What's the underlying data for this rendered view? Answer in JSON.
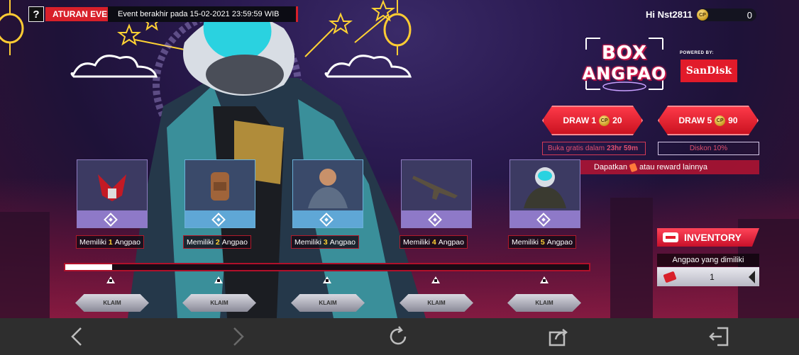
{
  "event": {
    "rules_button_icon": "question-icon",
    "rules_label": "ATURAN EVENT",
    "end_text": "Event berakhir pada 15-02-2021 23:59:59 WIB"
  },
  "user": {
    "greeting": "Hi Nst2811",
    "coin_icon": "cp-coin-icon",
    "coin_text": "CP",
    "balance": "0"
  },
  "logo": {
    "line1": "BOX",
    "line2": "ANGPAO",
    "powered_by": "POWERED BY:",
    "sponsor": "SanDisk"
  },
  "draw": [
    {
      "label": "DRAW 1",
      "cost": "20",
      "note_prefix": "Buka gratis dalam",
      "note_time": "23hr 59m"
    },
    {
      "label": "DRAW 5",
      "cost": "90",
      "note": "Diskon 10%"
    }
  ],
  "promo": {
    "before": "Dapatkan",
    "after": "atau reward lainnya"
  },
  "rewards": [
    {
      "icon": "winged-emblem-icon",
      "prefix": "Memiliki",
      "count": "1",
      "suffix": "Angpao"
    },
    {
      "icon": "backpack-icon",
      "prefix": "Memiliki",
      "count": "2",
      "suffix": "Angpao"
    },
    {
      "icon": "soldier-character-icon",
      "prefix": "Memiliki",
      "count": "3",
      "suffix": "Angpao"
    },
    {
      "icon": "rifle-icon",
      "prefix": "Memiliki",
      "count": "4",
      "suffix": "Angpao"
    },
    {
      "icon": "helmet-character-icon",
      "prefix": "Memiliki",
      "count": "5",
      "suffix": "Angpao"
    }
  ],
  "progress": {
    "fraction": 0.09
  },
  "claim_label": "KLAIM",
  "inventory": {
    "label": "INVENTORY",
    "owned_label": "Angpao yang dimiliki",
    "owned_count": "1"
  },
  "browser_nav": [
    "back-arrow-icon",
    "forward-arrow-icon",
    "refresh-icon",
    "share-icon",
    "exit-icon"
  ],
  "colors": {
    "accent_red": "#d8202a",
    "gold": "#ffd233",
    "card_purple": "#8e79c8",
    "card_blue": "#5fa7d6"
  }
}
